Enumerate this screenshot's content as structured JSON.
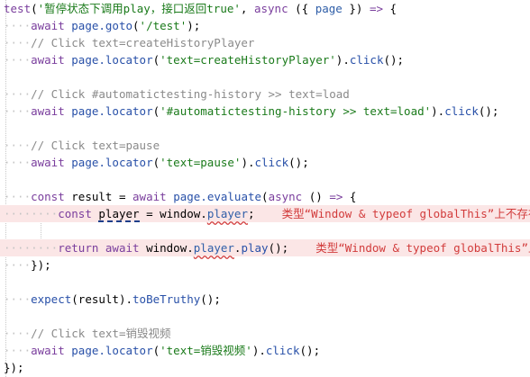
{
  "code": {
    "line1": {
      "kw": "test",
      "p1": "(",
      "str": "'暂停状态下调用play，接口返回true'",
      "p2": ", ",
      "kw2": "async",
      "p3": " ({ ",
      "prop": "page",
      "p4": " }) ",
      "arrow": "=>",
      "p5": " {"
    },
    "line2": {
      "kw": "await",
      "sp": " ",
      "fn": "page.goto",
      "p1": "(",
      "str": "'/test'",
      "p2": ");"
    },
    "line3": {
      "cm": "// Click text=createHistoryPlayer"
    },
    "line4": {
      "kw": "await",
      "sp": " ",
      "fn": "page.locator",
      "p1": "(",
      "str": "'text=createHistoryPlayer'",
      "p2": ").",
      "fn2": "click",
      "p3": "();"
    },
    "line6": {
      "cm": "// Click #automatictesting-history >> text=load"
    },
    "line7": {
      "kw": "await",
      "sp": " ",
      "fn": "page.locator",
      "p1": "(",
      "str": "'#automatictesting-history >> text=load'",
      "p2": ").",
      "fn2": "click",
      "p3": "();"
    },
    "line9": {
      "cm": "// Click text=pause"
    },
    "line10": {
      "kw": "await",
      "sp": " ",
      "fn": "page.locator",
      "p1": "(",
      "str": "'text=pause'",
      "p2": ").",
      "fn2": "click",
      "p3": "();"
    },
    "line12": {
      "kw": "const",
      "sp": " ",
      "var": "result",
      "eq": " = ",
      "kw2": "await",
      "sp2": " ",
      "fn": "page.evaluate",
      "p1": "(",
      "kw3": "async",
      "p2": " () ",
      "arrow": "=>",
      "p3": " {"
    },
    "line13": {
      "kw": "const",
      "sp": " ",
      "var": "player",
      "eq": " = ",
      "obj": "window.",
      "prop": "player",
      "p1": ";",
      "diag": "类型“Window & typeof globalThis”上不存在属性“player”。"
    },
    "line15": {
      "kw": "return",
      "sp": " ",
      "kw2": "await",
      "sp2": " ",
      "obj": "window.",
      "prop": "player",
      "dot": ".",
      "fn": "play",
      "p1": "();",
      "diag": "类型“Window & typeof globalThis”上不存在属性“player”。"
    },
    "line16": {
      "t": "});"
    },
    "line18": {
      "fn": "expect",
      "p1": "(",
      "var": "result",
      "p2": ").",
      "fn2": "toBeTruthy",
      "p3": "();"
    },
    "line20": {
      "cm": "// Click text=销毁视频"
    },
    "line21": {
      "kw": "await",
      "sp": " ",
      "fn": "page.locator",
      "p1": "(",
      "str": "'text=销毁视频'",
      "p2": ").",
      "fn2": "click",
      "p3": "();"
    },
    "line22": {
      "t": "});"
    }
  }
}
